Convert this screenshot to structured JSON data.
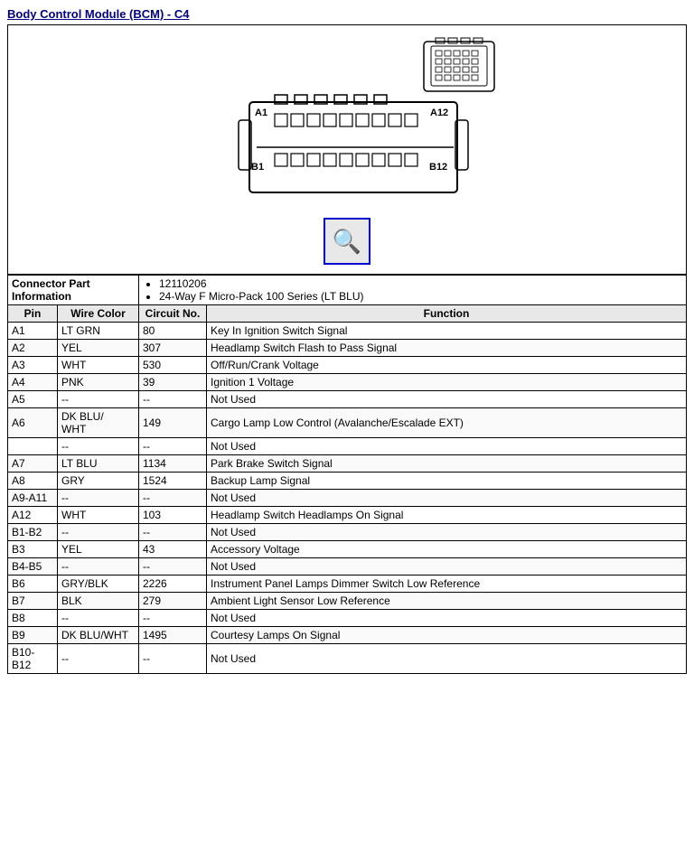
{
  "title": "Body Control Module (BCM) - C4",
  "connector_info": {
    "label": "Connector Part Information",
    "parts": [
      "12110206",
      "24-Way F Micro-Pack 100 Series (LT BLU)"
    ]
  },
  "table_headers": {
    "pin": "Pin",
    "wire_color": "Wire Color",
    "circuit_no": "Circuit No.",
    "function": "Function"
  },
  "rows": [
    {
      "pin": "A1",
      "wire": "LT GRN",
      "circuit": "80",
      "function": "Key In Ignition Switch Signal"
    },
    {
      "pin": "A2",
      "wire": "YEL",
      "circuit": "307",
      "function": "Headlamp Switch Flash to Pass Signal"
    },
    {
      "pin": "A3",
      "wire": "WHT",
      "circuit": "530",
      "function": "Off/Run/Crank Voltage"
    },
    {
      "pin": "A4",
      "wire": "PNK",
      "circuit": "39",
      "function": "Ignition 1 Voltage"
    },
    {
      "pin": "A5",
      "wire": "--",
      "circuit": "--",
      "function": "Not Used"
    },
    {
      "pin": "A6",
      "wire": "DK BLU/  WHT",
      "circuit": "149",
      "function": "Cargo Lamp Low Control (Avalanche/Escalade EXT)"
    },
    {
      "pin": "",
      "wire": "--",
      "circuit": "--",
      "function": "Not Used"
    },
    {
      "pin": "A7",
      "wire": "LT BLU",
      "circuit": "1134",
      "function": "Park Brake Switch Signal"
    },
    {
      "pin": "A8",
      "wire": "GRY",
      "circuit": "1524",
      "function": "Backup Lamp Signal"
    },
    {
      "pin": "A9-A11",
      "wire": "--",
      "circuit": "--",
      "function": "Not Used"
    },
    {
      "pin": "A12",
      "wire": "WHT",
      "circuit": "103",
      "function": "Headlamp Switch Headlamps On Signal"
    },
    {
      "pin": "B1-B2",
      "wire": "--",
      "circuit": "--",
      "function": "Not Used"
    },
    {
      "pin": "B3",
      "wire": "YEL",
      "circuit": "43",
      "function": "Accessory Voltage"
    },
    {
      "pin": "B4-B5",
      "wire": "--",
      "circuit": "--",
      "function": "Not Used"
    },
    {
      "pin": "B6",
      "wire": "GRY/BLK",
      "circuit": "2226",
      "function": "Instrument Panel Lamps Dimmer Switch Low Reference"
    },
    {
      "pin": "B7",
      "wire": "BLK",
      "circuit": "279",
      "function": "Ambient Light Sensor Low Reference"
    },
    {
      "pin": "B8",
      "wire": "--",
      "circuit": "--",
      "function": "Not Used"
    },
    {
      "pin": "B9",
      "wire": "DK BLU/WHT",
      "circuit": "1495",
      "function": "Courtesy Lamps On Signal"
    },
    {
      "pin": "B10-B12",
      "wire": "--",
      "circuit": "--",
      "function": "Not Used"
    }
  ]
}
